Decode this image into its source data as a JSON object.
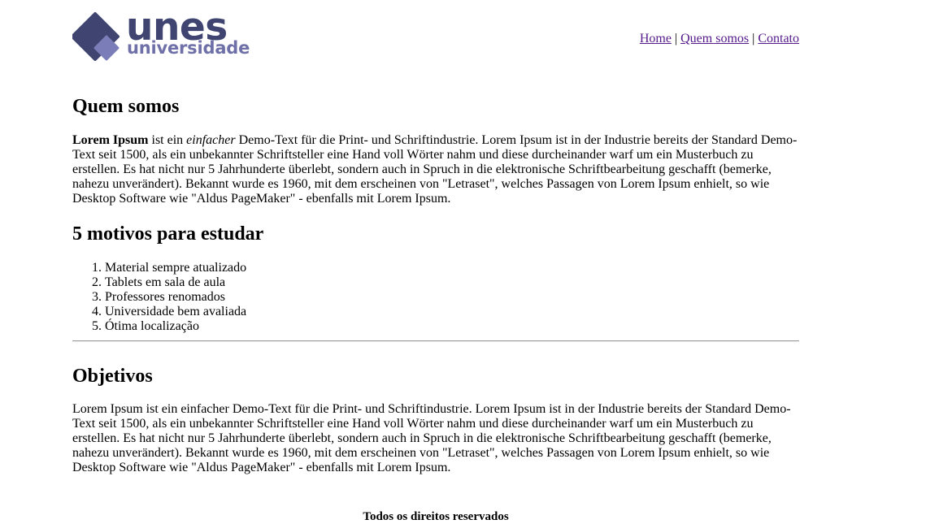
{
  "header": {
    "logo": {
      "word": "unes",
      "sub": "universidade"
    },
    "nav": {
      "home": "Home",
      "sep1": "|",
      "quem": "Quem somos",
      "sep2": "|",
      "contato": "Contato"
    }
  },
  "sections": {
    "quem": {
      "title": "Quem somos",
      "bold": "Lorem Ipsum",
      "t1": " ist ein ",
      "em": "einfacher",
      "t2": " Demo-Text für die Print- und Schriftindustrie. Lorem Ipsum ist in der Industrie bereits der Standard Demo-Text seit 1500, als ein unbekannter Schriftsteller eine Hand voll Wörter nahm und diese durcheinander warf um ein Musterbuch zu erstellen. Es hat nicht nur 5 Jahrhunderte überlebt, sondern auch in Spruch in die elektronische Schriftbearbeitung geschafft (bemerke, nahezu unverändert). Bekannt wurde es 1960, mit dem erscheinen von \"Letraset\", welches Passagen von Lorem Ipsum enhielt, so wie Desktop Software wie \"Aldus PageMaker\" - ebenfalls mit Lorem Ipsum."
    },
    "motivos": {
      "title": "5 motivos para estudar",
      "items": [
        "Material sempre atualizado",
        "Tablets em sala de aula",
        "Professores renomados",
        "Universidade bem avaliada",
        "Ótima localização"
      ]
    },
    "objetivos": {
      "title": "Objetivos",
      "text": "Lorem Ipsum ist ein einfacher Demo-Text für die Print- und Schriftindustrie. Lorem Ipsum ist in der Industrie bereits der Standard Demo-Text seit 1500, als ein unbekannter Schriftsteller eine Hand voll Wörter nahm und diese durcheinander warf um ein Musterbuch zu erstellen. Es hat nicht nur 5 Jahrhunderte überlebt, sondern auch in Spruch in die elektronische Schriftbearbeitung geschafft (bemerke, nahezu unverändert). Bekannt wurde es 1960, mit dem erscheinen von \"Letraset\", welches Passagen von Lorem Ipsum enhielt, so wie Desktop Software wie \"Aldus PageMaker\" - ebenfalls mit Lorem Ipsum."
    }
  },
  "footer": {
    "text": "Todos os direitos reservados"
  },
  "colors": {
    "logo_dark": "#3f4570",
    "logo_light": "#6f70a8",
    "link": "#551a8b"
  }
}
